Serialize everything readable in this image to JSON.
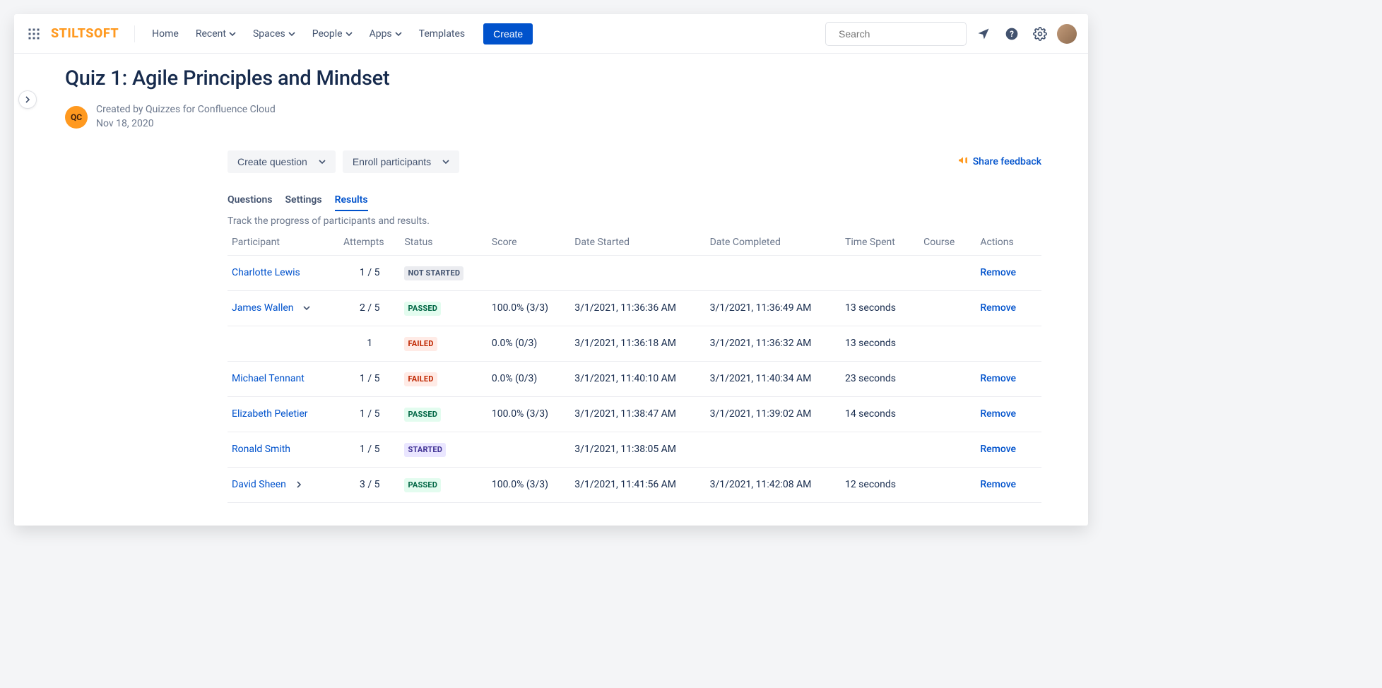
{
  "brand": "STILTSOFT",
  "nav": {
    "home": "Home",
    "recent": "Recent",
    "spaces": "Spaces",
    "people": "People",
    "apps": "Apps",
    "templates": "Templates",
    "create": "Create"
  },
  "search": {
    "placeholder": "Search"
  },
  "page": {
    "title": "Quiz 1: Agile Principles and Mindset",
    "avatar_initials": "QC",
    "created_by": "Created by Quizzes for Confluence Cloud",
    "created_date": "Nov 18, 2020"
  },
  "toolbar": {
    "create_question": "Create question",
    "enroll": "Enroll participants",
    "feedback": "Share feedback"
  },
  "tabs": {
    "questions": "Questions",
    "settings": "Settings",
    "results": "Results",
    "description": "Track the progress of participants and results."
  },
  "columns": {
    "participant": "Participant",
    "attempts": "Attempts",
    "status": "Status",
    "score": "Score",
    "date_started": "Date Started",
    "date_completed": "Date Completed",
    "time_spent": "Time Spent",
    "course": "Course",
    "actions": "Actions"
  },
  "status_labels": {
    "not_started": "NOT STARTED",
    "passed": "PASSED",
    "failed": "FAILED",
    "started": "STARTED"
  },
  "action_remove": "Remove",
  "rows": [
    {
      "participant": "Charlotte Lewis",
      "expand": "",
      "attempts": "1 / 5",
      "status": "not_started",
      "score": "",
      "started": "",
      "completed": "",
      "time": "",
      "course": ""
    },
    {
      "participant": "James Wallen",
      "expand": "down",
      "attempts": "2 / 5",
      "status": "passed",
      "score": "100.0% (3/3)",
      "started": "3/1/2021, 11:36:36 AM",
      "completed": "3/1/2021, 11:36:49 AM",
      "time": "13 seconds",
      "course": ""
    },
    {
      "sub": true,
      "attempts": "1",
      "status": "failed",
      "score": "0.0% (0/3)",
      "started": "3/1/2021, 11:36:18 AM",
      "completed": "3/1/2021, 11:36:32 AM",
      "time": "13 seconds"
    },
    {
      "participant": "Michael Tennant",
      "expand": "",
      "attempts": "1 / 5",
      "status": "failed",
      "score": "0.0% (0/3)",
      "started": "3/1/2021, 11:40:10 AM",
      "completed": "3/1/2021, 11:40:34 AM",
      "time": "23 seconds",
      "course": ""
    },
    {
      "participant": "Elizabeth Peletier",
      "expand": "",
      "attempts": "1 / 5",
      "status": "passed",
      "score": "100.0% (3/3)",
      "started": "3/1/2021, 11:38:47 AM",
      "completed": "3/1/2021, 11:39:02 AM",
      "time": "14 seconds",
      "course": ""
    },
    {
      "participant": "Ronald Smith",
      "expand": "",
      "attempts": "1 / 5",
      "status": "started",
      "score": "",
      "started": "3/1/2021, 11:38:05 AM",
      "completed": "",
      "time": "",
      "course": ""
    },
    {
      "participant": "David Sheen",
      "expand": "right",
      "attempts": "3 / 5",
      "status": "passed",
      "score": "100.0% (3/3)",
      "started": "3/1/2021, 11:41:56 AM",
      "completed": "3/1/2021, 11:42:08 AM",
      "time": "12 seconds",
      "course": ""
    }
  ]
}
